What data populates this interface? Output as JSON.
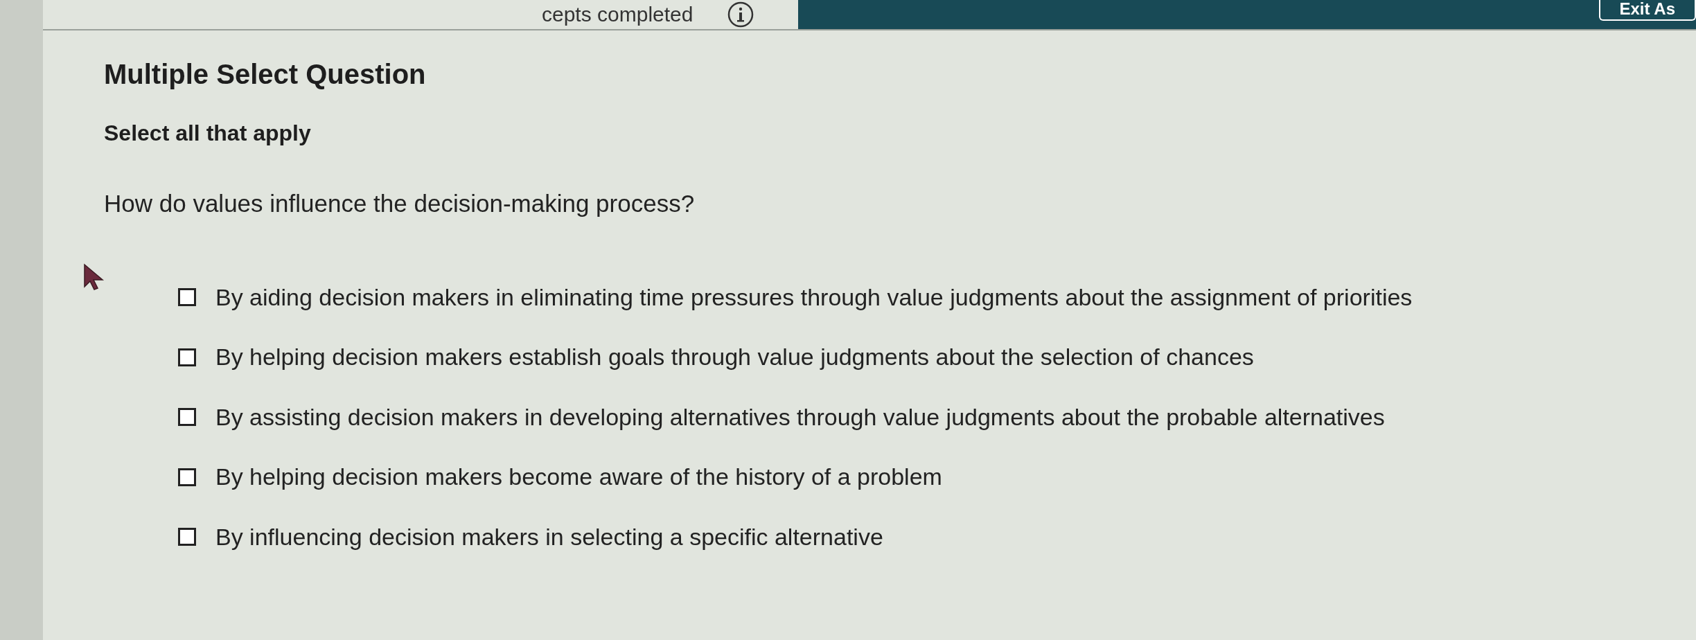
{
  "header": {
    "progress_text": "cepts completed",
    "exit_button": "Exit As"
  },
  "question": {
    "type_label": "Multiple Select Question",
    "instruction": "Select all that apply",
    "prompt": "How do values influence the decision-making process?",
    "options": [
      {
        "label": "By aiding decision makers in eliminating time pressures through value judgments about the assignment of priorities",
        "checked": false
      },
      {
        "label": "By helping decision makers establish goals through value judgments about the selection of chances",
        "checked": false
      },
      {
        "label": "By assisting decision makers in developing alternatives through value judgments about the probable alternatives",
        "checked": false
      },
      {
        "label": "By helping decision makers become aware of the history of a problem",
        "checked": false
      },
      {
        "label": "By influencing decision makers in selecting a specific alternative",
        "checked": false
      }
    ]
  }
}
